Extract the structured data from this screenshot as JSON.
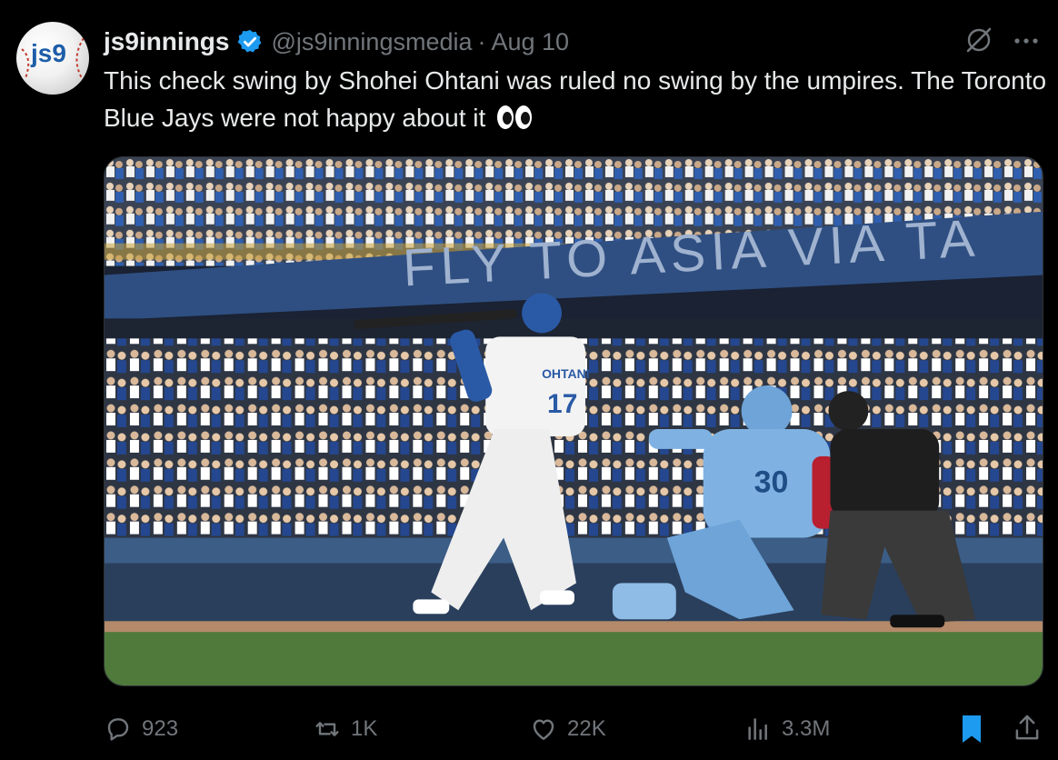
{
  "tweet": {
    "display_name": "js9innings",
    "handle": "@js9inningsmedia",
    "separator": "·",
    "date": "Aug 10",
    "text": "This check swing by Shohei Ohtani was ruled no swing by the umpires. The Toronto Blue Jays were not happy about it",
    "emoji": "eyes-emoji",
    "avatar_logo": "js9",
    "verified_color": "#1d9bf0"
  },
  "media": {
    "banner_text": "FLY TO ASIA VIA TA",
    "jersey_name": "OHTANI",
    "jersey_number": "17",
    "catcher_number": "30"
  },
  "actions": {
    "replies": "923",
    "reposts": "1K",
    "likes": "22K",
    "views": "3.3M"
  },
  "icons": {
    "reply": "reply-icon",
    "repost": "repost-icon",
    "like": "heart-icon",
    "views": "views-chart-icon",
    "bookmark": "bookmark-icon",
    "share": "share-icon",
    "grok": "grok-icon",
    "more": "more-icon"
  },
  "colors": {
    "background": "#000000",
    "text": "#e7e9ea",
    "muted": "#71767b",
    "accent": "#1d9bf0"
  }
}
